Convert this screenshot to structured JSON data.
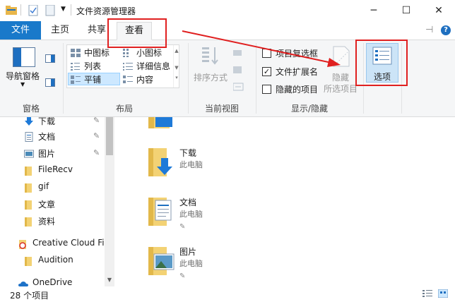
{
  "window": {
    "title": "文件资源管理器",
    "controls": {
      "minimize": "─",
      "maximize": "☐",
      "close": "✕"
    }
  },
  "tabs": {
    "file": "文件",
    "home": "主页",
    "share": "共享",
    "view": "查看"
  },
  "ribbon": {
    "panes": {
      "nav_pane": "导航窗格",
      "group": "窗格"
    },
    "layout": {
      "group": "布局",
      "items": [
        "中图标",
        "小图标",
        "列表",
        "详细信息",
        "平铺",
        "内容"
      ],
      "selected": "平铺"
    },
    "current_view": {
      "sort_by": "排序方式",
      "group": "当前视图"
    },
    "show_hide": {
      "group": "显示/隐藏",
      "item_checkboxes": {
        "label": "项目复选框",
        "checked": false
      },
      "file_extensions": {
        "label": "文件扩展名",
        "checked": true
      },
      "hidden_items": {
        "label": "隐藏的项目",
        "checked": false
      },
      "hide_selected_1": "隐藏",
      "hide_selected_2": "所选项目"
    },
    "options": "选项"
  },
  "nav": {
    "items": [
      {
        "label": "下载",
        "icon": "download-icon",
        "pinned": true
      },
      {
        "label": "文档",
        "icon": "document-icon",
        "pinned": true
      },
      {
        "label": "图片",
        "icon": "picture-icon",
        "pinned": true
      },
      {
        "label": "FileRecv",
        "icon": "folder-icon",
        "pinned": false
      },
      {
        "label": "gif",
        "icon": "folder-icon",
        "pinned": false
      },
      {
        "label": "文章",
        "icon": "folder-icon",
        "pinned": false
      },
      {
        "label": "资料",
        "icon": "folder-icon",
        "pinned": false
      },
      {
        "label": "Creative Cloud Fil",
        "icon": "creative-cloud-icon",
        "pinned": false
      },
      {
        "label": "Audition",
        "icon": "folder-icon",
        "pinned": false
      },
      {
        "label": "OneDrive",
        "icon": "onedrive-icon",
        "pinned": false
      }
    ]
  },
  "content": {
    "items": [
      {
        "name": "下载",
        "location": "此电脑",
        "icon": "download-folder-icon"
      },
      {
        "name": "文档",
        "location": "此电脑",
        "icon": "documents-folder-icon"
      },
      {
        "name": "图片",
        "location": "此电脑",
        "icon": "pictures-folder-icon"
      }
    ]
  },
  "status": {
    "count": "28 个项目"
  }
}
